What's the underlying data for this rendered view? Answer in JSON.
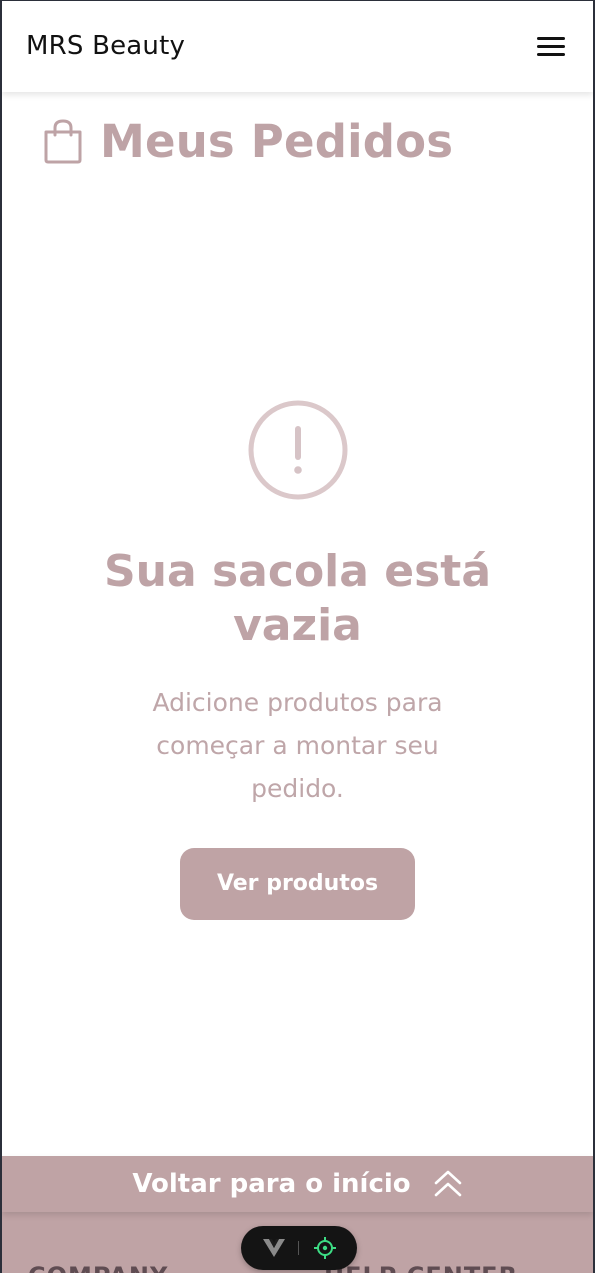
{
  "header": {
    "brand": "MRS Beauty",
    "menu_icon": "hamburger-menu-icon"
  },
  "page": {
    "title": "Meus Pedidos",
    "title_icon": "shopping-bag-icon"
  },
  "empty_state": {
    "icon": "alert-circle-icon",
    "title": "Sua sacola está vazia",
    "description": "Adicione produtos para começar a montar seu pedido.",
    "cta_label": "Ver produtos"
  },
  "back_to_top": {
    "label": "Voltar para o início",
    "icon": "double-chevron-up-icon"
  },
  "footer": {
    "col1": "COMPANY",
    "col2": "HELP CENTER"
  },
  "dev_toolbar": {
    "logo_icon": "vue-logo-icon",
    "inspect_icon": "crosshair-target-icon"
  },
  "colors": {
    "accent": "#bfa3a5",
    "title": "#bea3a6",
    "text_muted": "#bfa6a9",
    "footer_text": "#5f4c52",
    "brand_text": "#111111"
  }
}
